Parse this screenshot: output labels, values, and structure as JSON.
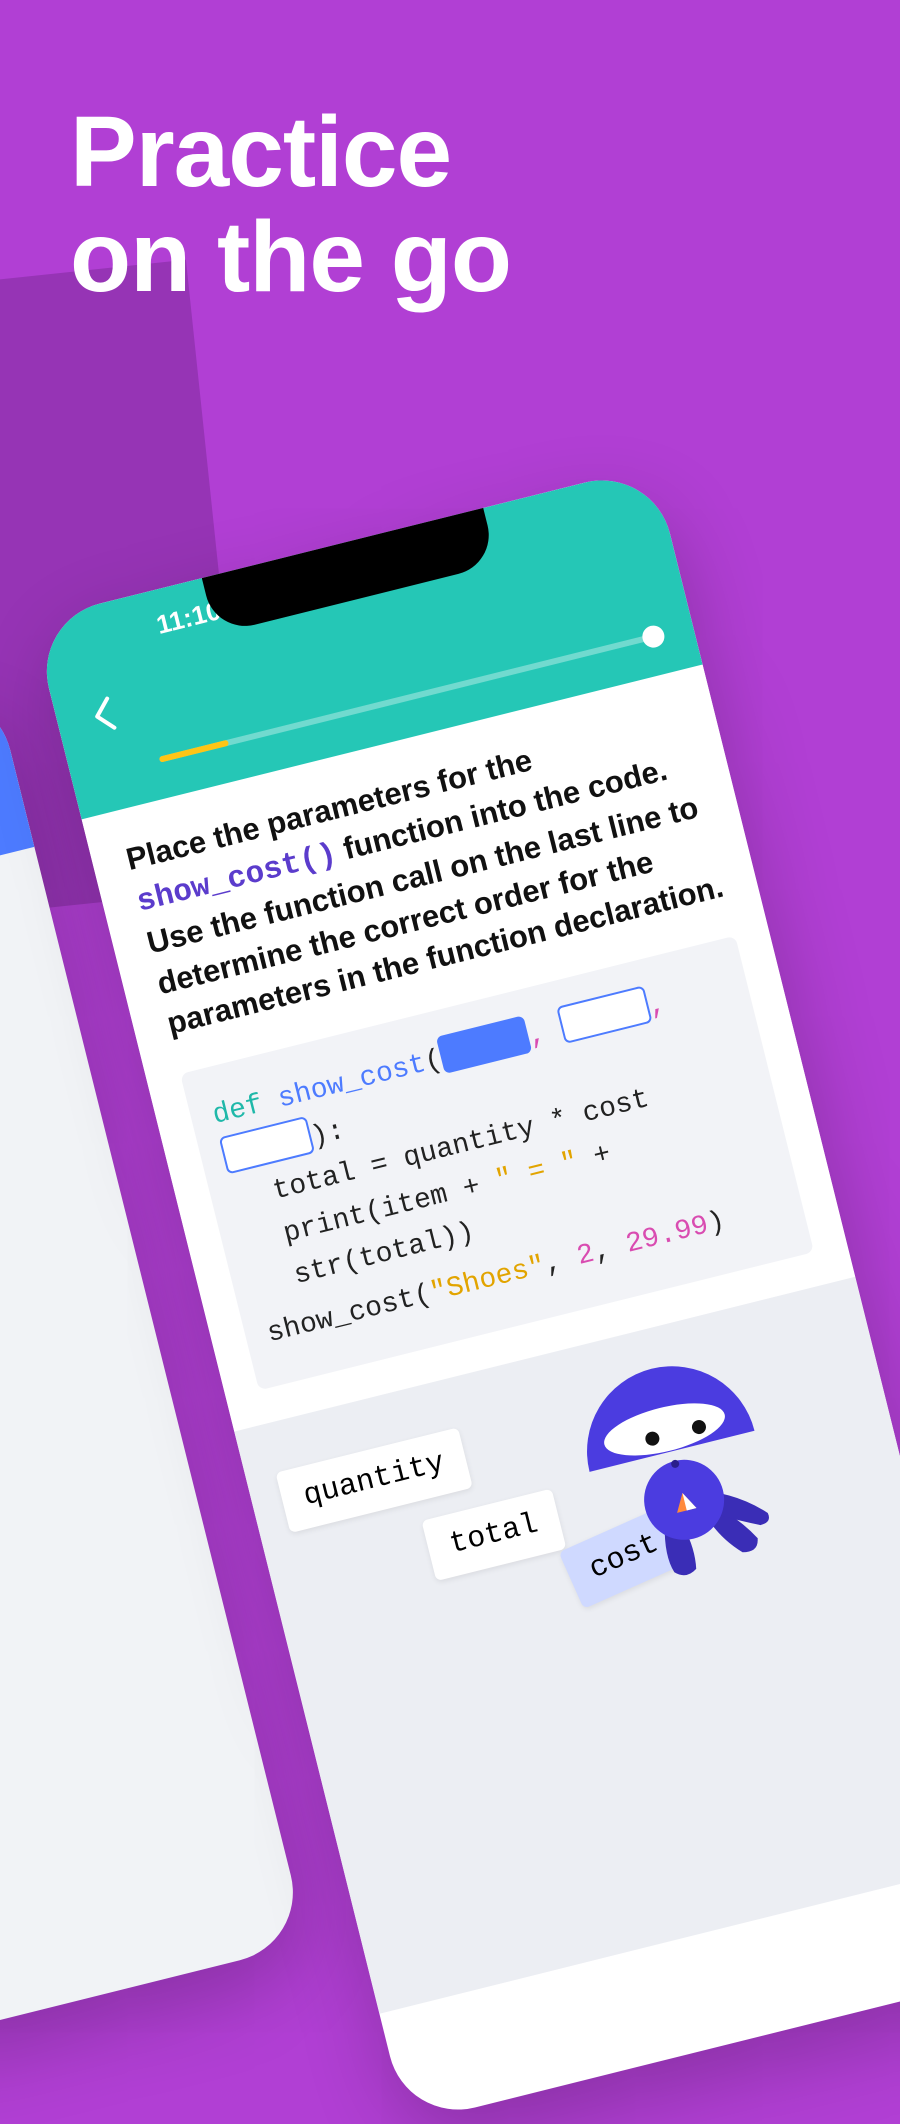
{
  "headline_line1": "Practice",
  "headline_line2": "on the go",
  "front_phone": {
    "time": "11:10",
    "prompt_pre": "Place the parameters for the ",
    "prompt_fn": "show_cost()",
    "prompt_post": " function into the code. Use the function call on the last line to determine the correct order for the parameters in the function declaration.",
    "code": {
      "def": "def",
      "fn": "show_cost",
      "body1": "total = quantity * cost",
      "body2a": "print(item + ",
      "body2_str": "\" = \"",
      "body2b": " + str(total))",
      "call_pre": "show_cost(",
      "call_str": "\"Shoes\"",
      "call_n1": "2",
      "call_n2": "29.99",
      "call_post": ")"
    },
    "tokens": {
      "quantity": "quantity",
      "total": "total",
      "cost": "cost"
    }
  }
}
